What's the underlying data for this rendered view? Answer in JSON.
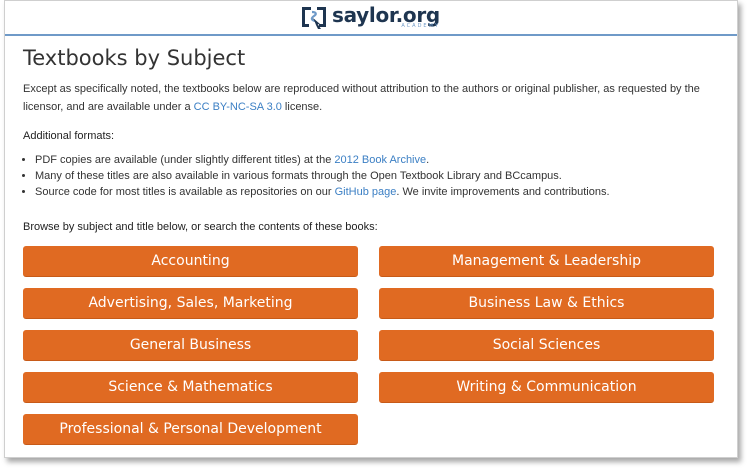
{
  "header": {
    "logo_text": "saylor.org",
    "logo_subtext": "ACADEMY",
    "logo_icon": "saylor-logo-icon"
  },
  "page": {
    "title": "Textbooks by Subject",
    "intro_before": "Except as specifically noted, the textbooks below are reproduced without attribution to the authors or original publisher, as requested by the licensor, and are available under a ",
    "intro_link": "CC BY-NC-SA 3.0",
    "intro_after": " license.",
    "formats_heading": "Additional formats:",
    "formats": [
      {
        "before": "PDF copies are available (under slightly different titles) at the ",
        "link": "2012 Book Archive",
        "after": "."
      },
      {
        "before": "Many of these titles are also available in various formats through the Open Textbook Library and BCcampus.",
        "link": "",
        "after": ""
      },
      {
        "before": "Source code for most titles is available as repositories on our ",
        "link": "GitHub page",
        "after": ". We invite improvements and contributions."
      }
    ],
    "browse_text": "Browse by subject and title below, or search the contents of these books:"
  },
  "subjects": [
    "Accounting",
    "Management & Leadership",
    "Advertising, Sales, Marketing",
    "Business Law & Ethics",
    "General Business",
    "Social Sciences",
    "Science & Mathematics",
    "Writing & Communication",
    "Professional & Personal Development"
  ],
  "colors": {
    "button_bg": "#e06a22",
    "link": "#3b7fc4",
    "brand_dark": "#1e3550",
    "brand_accent": "#6f9ac8"
  }
}
